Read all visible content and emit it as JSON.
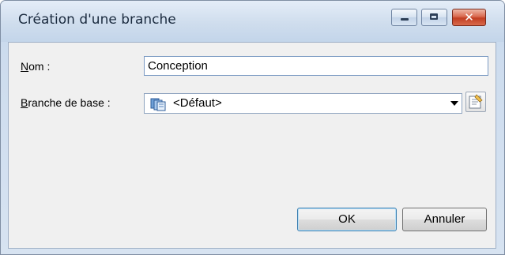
{
  "window": {
    "title": "Création d'une branche",
    "close_glyph": "✕"
  },
  "form": {
    "name_label_accel": "N",
    "name_label_rest": "om :",
    "name_value": "Conception",
    "base_label_accel": "B",
    "base_label_rest": "ranche de base :",
    "base_value": "<Défaut>",
    "base_icon": "branch-icon",
    "properties_icon": "properties-icon"
  },
  "buttons": {
    "ok": "OK",
    "cancel": "Annuler"
  }
}
